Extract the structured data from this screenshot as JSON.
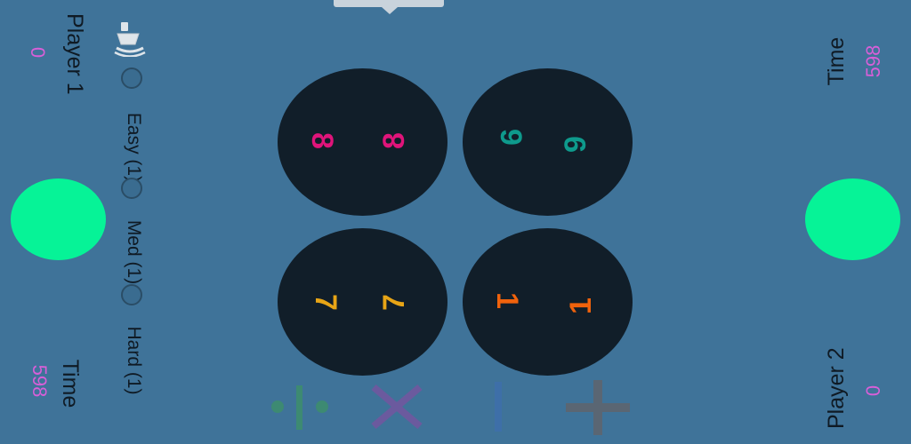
{
  "player1": {
    "name": "Player 1",
    "score": "0",
    "time_label": "Time",
    "time_value": "598"
  },
  "player2": {
    "name": "Player 2",
    "score": "0",
    "time_label": "Time",
    "time_value": "598"
  },
  "difficulty": {
    "options": [
      {
        "label": "Easy (1)",
        "selected": false
      },
      {
        "label": "Med (1)",
        "selected": false
      },
      {
        "label": "Hard (1)",
        "selected": false
      }
    ]
  },
  "tiles": [
    {
      "value": "8",
      "color": "#e0147a"
    },
    {
      "value": "9",
      "color": "#0e9a8c"
    },
    {
      "value": "7",
      "color": "#e8a516"
    },
    {
      "value": "1",
      "color": "#f0620c"
    }
  ],
  "operators": [
    {
      "symbol": "÷",
      "icon": "divide-icon",
      "color": "#3d8a72"
    },
    {
      "symbol": "×",
      "icon": "multiply-icon",
      "color": "#6b5a9e"
    },
    {
      "symbol": "−",
      "icon": "minus-icon",
      "color": "#3e6fa8"
    },
    {
      "symbol": "+",
      "icon": "plus-icon",
      "color": "#5a6673"
    }
  ],
  "colors": {
    "background": "#3f7399",
    "buzzer": "#06f397",
    "tile": "#111e29",
    "text_dark": "#0f1a24",
    "text_accent": "#d85fd8"
  },
  "icons": {
    "sound": "speaker-icon"
  }
}
